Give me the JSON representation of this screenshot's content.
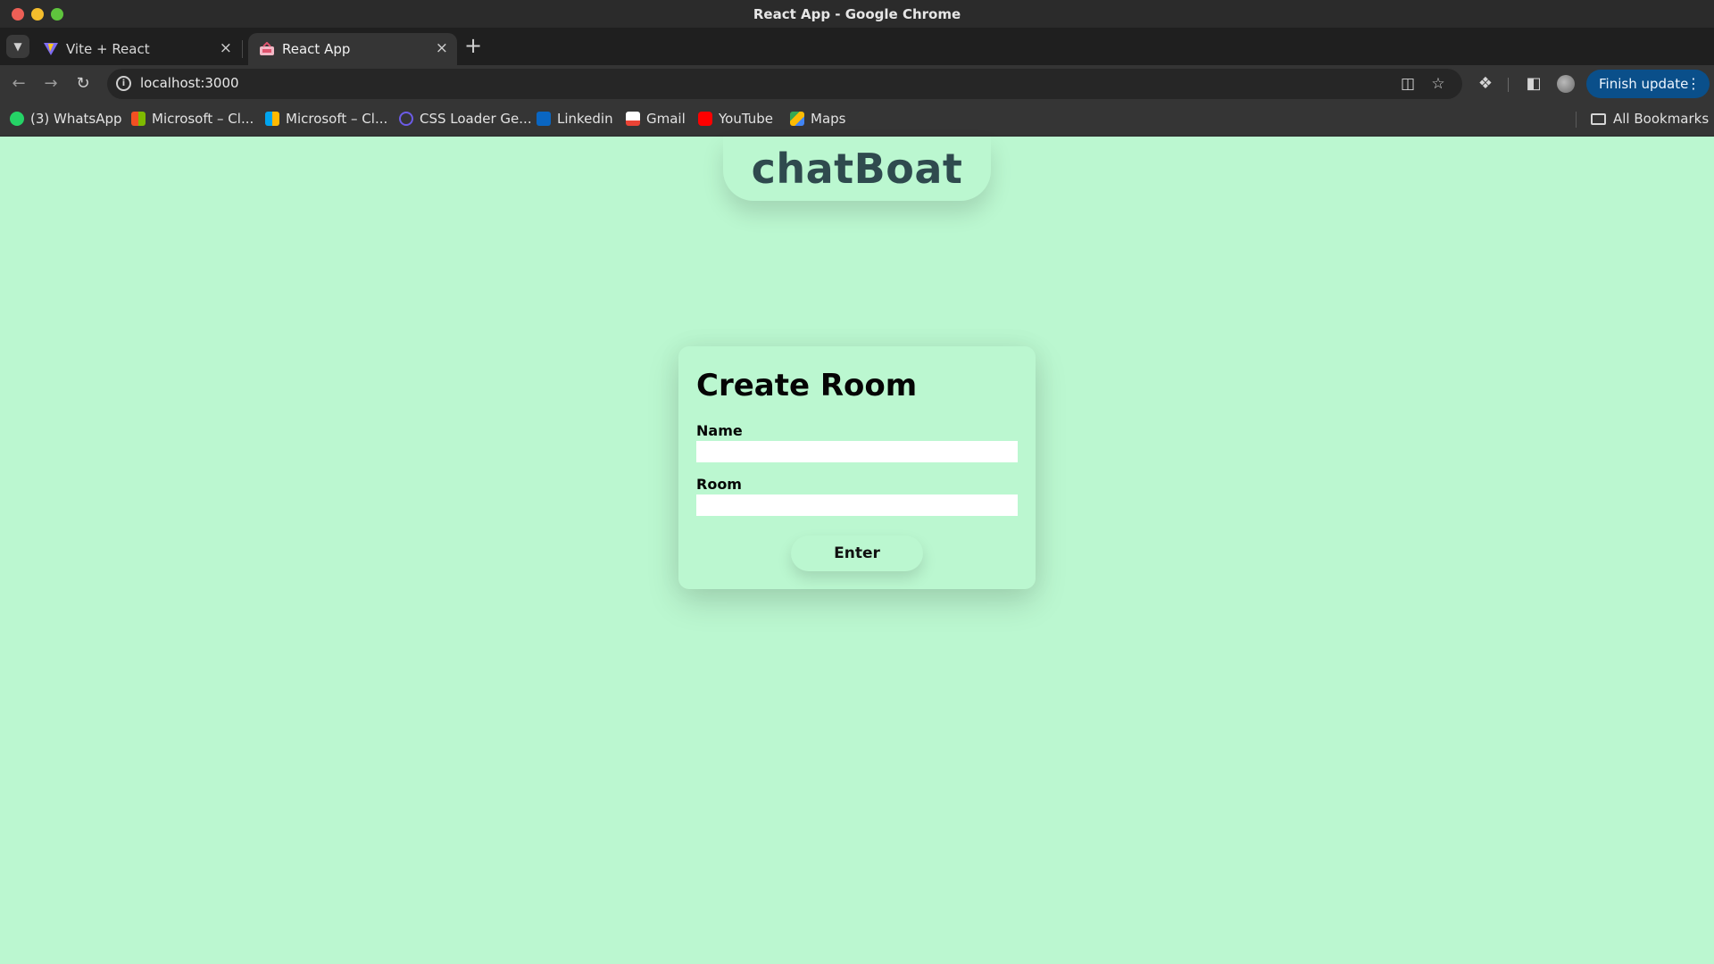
{
  "window": {
    "title": "React App - Google Chrome"
  },
  "tabs": [
    {
      "label": "Vite + React",
      "icon": "vite-logo-icon",
      "active": false
    },
    {
      "label": "React App",
      "icon": "react-app-favicon-icon",
      "active": true
    }
  ],
  "toolbar": {
    "url": "localhost:3000",
    "update_label": "Finish update"
  },
  "bookmarks": [
    {
      "label": "(3) WhatsApp",
      "icon": "whatsapp-icon",
      "color": "#25d366"
    },
    {
      "label": "Microsoft – Cl...",
      "icon": "microsoft-icon",
      "color": "#f25022"
    },
    {
      "label": "Microsoft – Cl...",
      "icon": "microsoft-icon",
      "color": "#f25022"
    },
    {
      "label": "CSS Loader Ge...",
      "icon": "css-loader-icon",
      "color": "#6c5ce7"
    },
    {
      "label": "Linkedin",
      "icon": "linkedin-icon",
      "color": "#0a66c2"
    },
    {
      "label": "Gmail",
      "icon": "gmail-icon",
      "color": "#ea4335"
    },
    {
      "label": "YouTube",
      "icon": "youtube-icon",
      "color": "#ff0000"
    },
    {
      "label": "Maps",
      "icon": "maps-icon",
      "color": "#34a853"
    }
  ],
  "all_bookmarks_label": "All Bookmarks",
  "app": {
    "brand": "chatBoat",
    "background": "#bbf7d0",
    "form": {
      "title": "Create Room",
      "name_label": "Name",
      "name_value": "",
      "room_label": "Room",
      "room_value": "",
      "submit_label": "Enter"
    }
  }
}
